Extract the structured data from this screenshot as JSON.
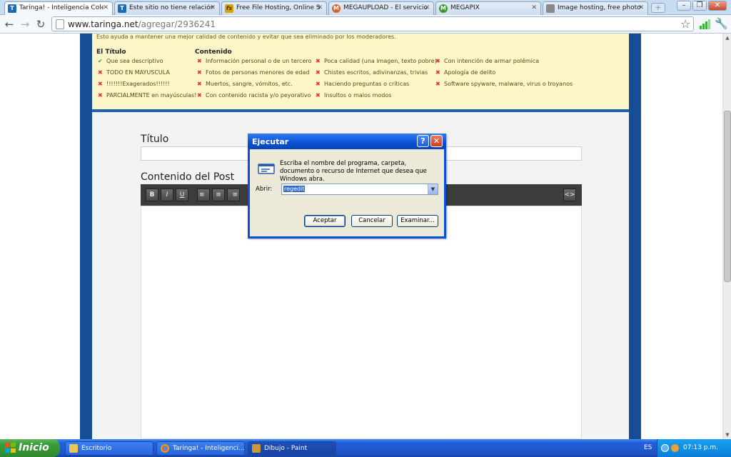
{
  "browser": {
    "tabs": [
      {
        "label": "Taringa! - Inteligencia Colecti",
        "favicon": "T",
        "color": "#1d6ab8"
      },
      {
        "label": "Este sitio no tiene relación co",
        "favicon": "T",
        "color": "#1d6ab8"
      },
      {
        "label": "Free File Hosting, Online Stor",
        "favicon": "fs",
        "color": "#d9a400"
      },
      {
        "label": "MEGAUPLOAD - El servicio líd",
        "favicon": "M",
        "color": "#d8632a"
      },
      {
        "label": "MEGAPIX",
        "favicon": "M",
        "color": "#3a9b2a"
      },
      {
        "label": "Image hosting, free photo sh",
        "favicon": "",
        "color": "#7a7a7a"
      }
    ],
    "url_host": "www.taringa.net",
    "url_path": "/agregar/2936241"
  },
  "rules": {
    "intro": "Esto ayuda a mantener una mejor calidad de contenido y evitar que sea eliminado por los moderadores.",
    "head_titulo": "El Título",
    "head_contenido": "Contenido",
    "col1": [
      {
        "mark": "ok",
        "text": "Que sea descriptivo"
      },
      {
        "mark": "no",
        "text": "TODO EN MAYUSCULA"
      },
      {
        "mark": "no",
        "text": "!!!!!!!Exagerados!!!!!!"
      },
      {
        "mark": "no",
        "text": "PARCIALMENTE en mayúsculas!"
      }
    ],
    "col2": [
      {
        "mark": "no",
        "text": "Información personal o de un tercero"
      },
      {
        "mark": "no",
        "text": "Fotos de personas menores de edad"
      },
      {
        "mark": "no",
        "text": "Muertos, sangre, vómitos, etc."
      },
      {
        "mark": "no",
        "text": "Con contenido racista y/o peyorativo"
      }
    ],
    "col3": [
      {
        "mark": "no",
        "text": "Poca calidad (una imagen, texto pobre)"
      },
      {
        "mark": "no",
        "text": "Chistes escritos, adivinanzas, trivias"
      },
      {
        "mark": "no",
        "text": "Haciendo preguntas o críticas"
      },
      {
        "mark": "no",
        "text": "Insultos o malos modos"
      }
    ],
    "col4": [
      {
        "mark": "no",
        "text": "Con intención de armar polémica"
      },
      {
        "mark": "no",
        "text": "Apología de delito"
      },
      {
        "mark": "no",
        "text": "Software spyware, malware, virus o troyanos"
      }
    ]
  },
  "form": {
    "titulo_label": "Título",
    "contenido_label": "Contenido del Post",
    "editor_buttons": [
      "B",
      "I",
      "U",
      "≡",
      "≡",
      "≡"
    ],
    "source_button": "<>"
  },
  "dialog": {
    "title": "Ejecutar",
    "help": "?",
    "close": "✕",
    "message": "Escriba el nombre del programa, carpeta, documento o recurso de Internet que desea que Windows abra.",
    "abrir_label": "Abrir:",
    "abrir_value": "regedit",
    "ok_label": "Aceptar",
    "cancel_label": "Cancelar",
    "browse_label": "Examinar..."
  },
  "taskbar": {
    "start_label": "Inicio",
    "items": [
      {
        "label": "Escritorio"
      },
      {
        "label": "Taringa! - Inteligenci..."
      },
      {
        "label": "Dibujo - Paint"
      }
    ],
    "lang": "ES",
    "clock": "07:13 p.m."
  }
}
